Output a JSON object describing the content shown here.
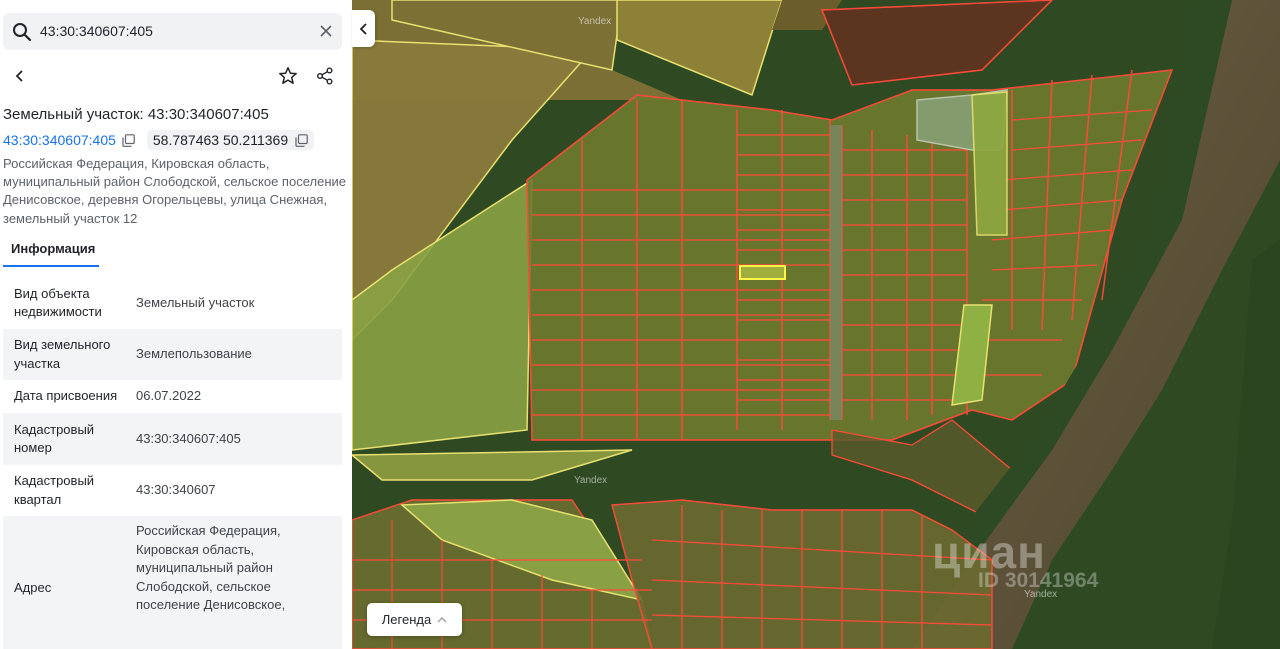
{
  "search": {
    "value": "43:30:340607:405"
  },
  "parcel": {
    "title": "Земельный участок: 43:30:340607:405",
    "cadastral_link": "43:30:340607:405",
    "coordinates": "58.787463 50.211369",
    "address_lines": [
      "Российская Федерация, Кировская область,",
      "муниципальный район Слободской, сельское поселение",
      "Денисовское, деревня Огорельцевы, улица Снежная,",
      "земельный участок 12"
    ]
  },
  "tabs": {
    "info": "Информация"
  },
  "info_rows": [
    {
      "key": "Вид объекта недвижимости",
      "value": "Земельный участок"
    },
    {
      "key": "Вид земельного участка",
      "value": "Землепользование"
    },
    {
      "key": "Дата присвоения",
      "value": "06.07.2022"
    },
    {
      "key": "Кадастровый номер",
      "value": "43:30:340607:405"
    },
    {
      "key": "Кадастровый квартал",
      "value": "43:30:340607"
    },
    {
      "key": "Адрес",
      "value_lines": [
        "Российская Федерация,",
        "Кировская область,",
        "муниципальный район",
        "Слободской, сельское",
        "поселение Денисовское,"
      ]
    }
  ],
  "map": {
    "legend_label": "Легенда",
    "watermarks": [
      "Yandex",
      "Yandex",
      "Yandex"
    ],
    "cian_brand": "циан",
    "cian_id": "ID 30141964"
  },
  "colors": {
    "accent": "#1a73e8",
    "parcel_outline": "#ff4a3a",
    "selected_outline": "#fff44a"
  },
  "icons": [
    "search-icon",
    "close-icon",
    "chevron-left-icon",
    "star-icon",
    "share-icon",
    "copy-icon",
    "chevron-up-icon"
  ]
}
